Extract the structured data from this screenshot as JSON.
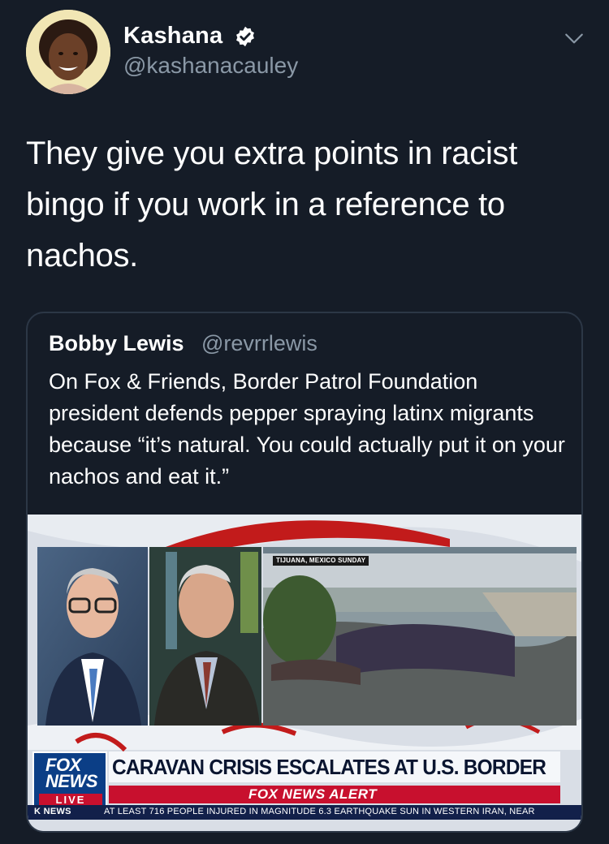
{
  "author": {
    "display_name": "Kashana",
    "handle": "@kashanacauley",
    "verified": true
  },
  "tweet": {
    "text": "They give you extra points in racist bingo if you work in a reference to nachos."
  },
  "quoted_tweet": {
    "display_name": "Bobby Lewis",
    "handle": "@revrrlewis",
    "text": "On Fox & Friends, Border Patrol Foundation president defends pepper spraying latinx migrants because “it’s natural. You could actually put it on your nachos and eat it.”",
    "media": {
      "location_tag": "TIJUANA, MEXICO SUNDAY",
      "logo_line1": "FOX",
      "logo_line2": "NEWS",
      "logo_live": "LIVE",
      "headline": "CARAVAN CRISIS ESCALATES AT U.S. BORDER",
      "alert": "FOX NEWS ALERT",
      "ticker_label": "K NEWS",
      "ticker_text": "AT LEAST 716 PEOPLE INJURED IN MAGNITUDE 6.3 EARTHQUAKE SUN IN WESTERN IRAN, NEAR"
    }
  },
  "colors": {
    "background": "#151c27",
    "secondary_text": "#8a98a6",
    "verified_blue": "#ffffff",
    "border": "#2c3746",
    "fox_blue": "#0b3e86",
    "fox_red": "#c8102e"
  },
  "icons": {
    "verified": "verified-badge-icon",
    "menu": "chevron-down-icon"
  }
}
